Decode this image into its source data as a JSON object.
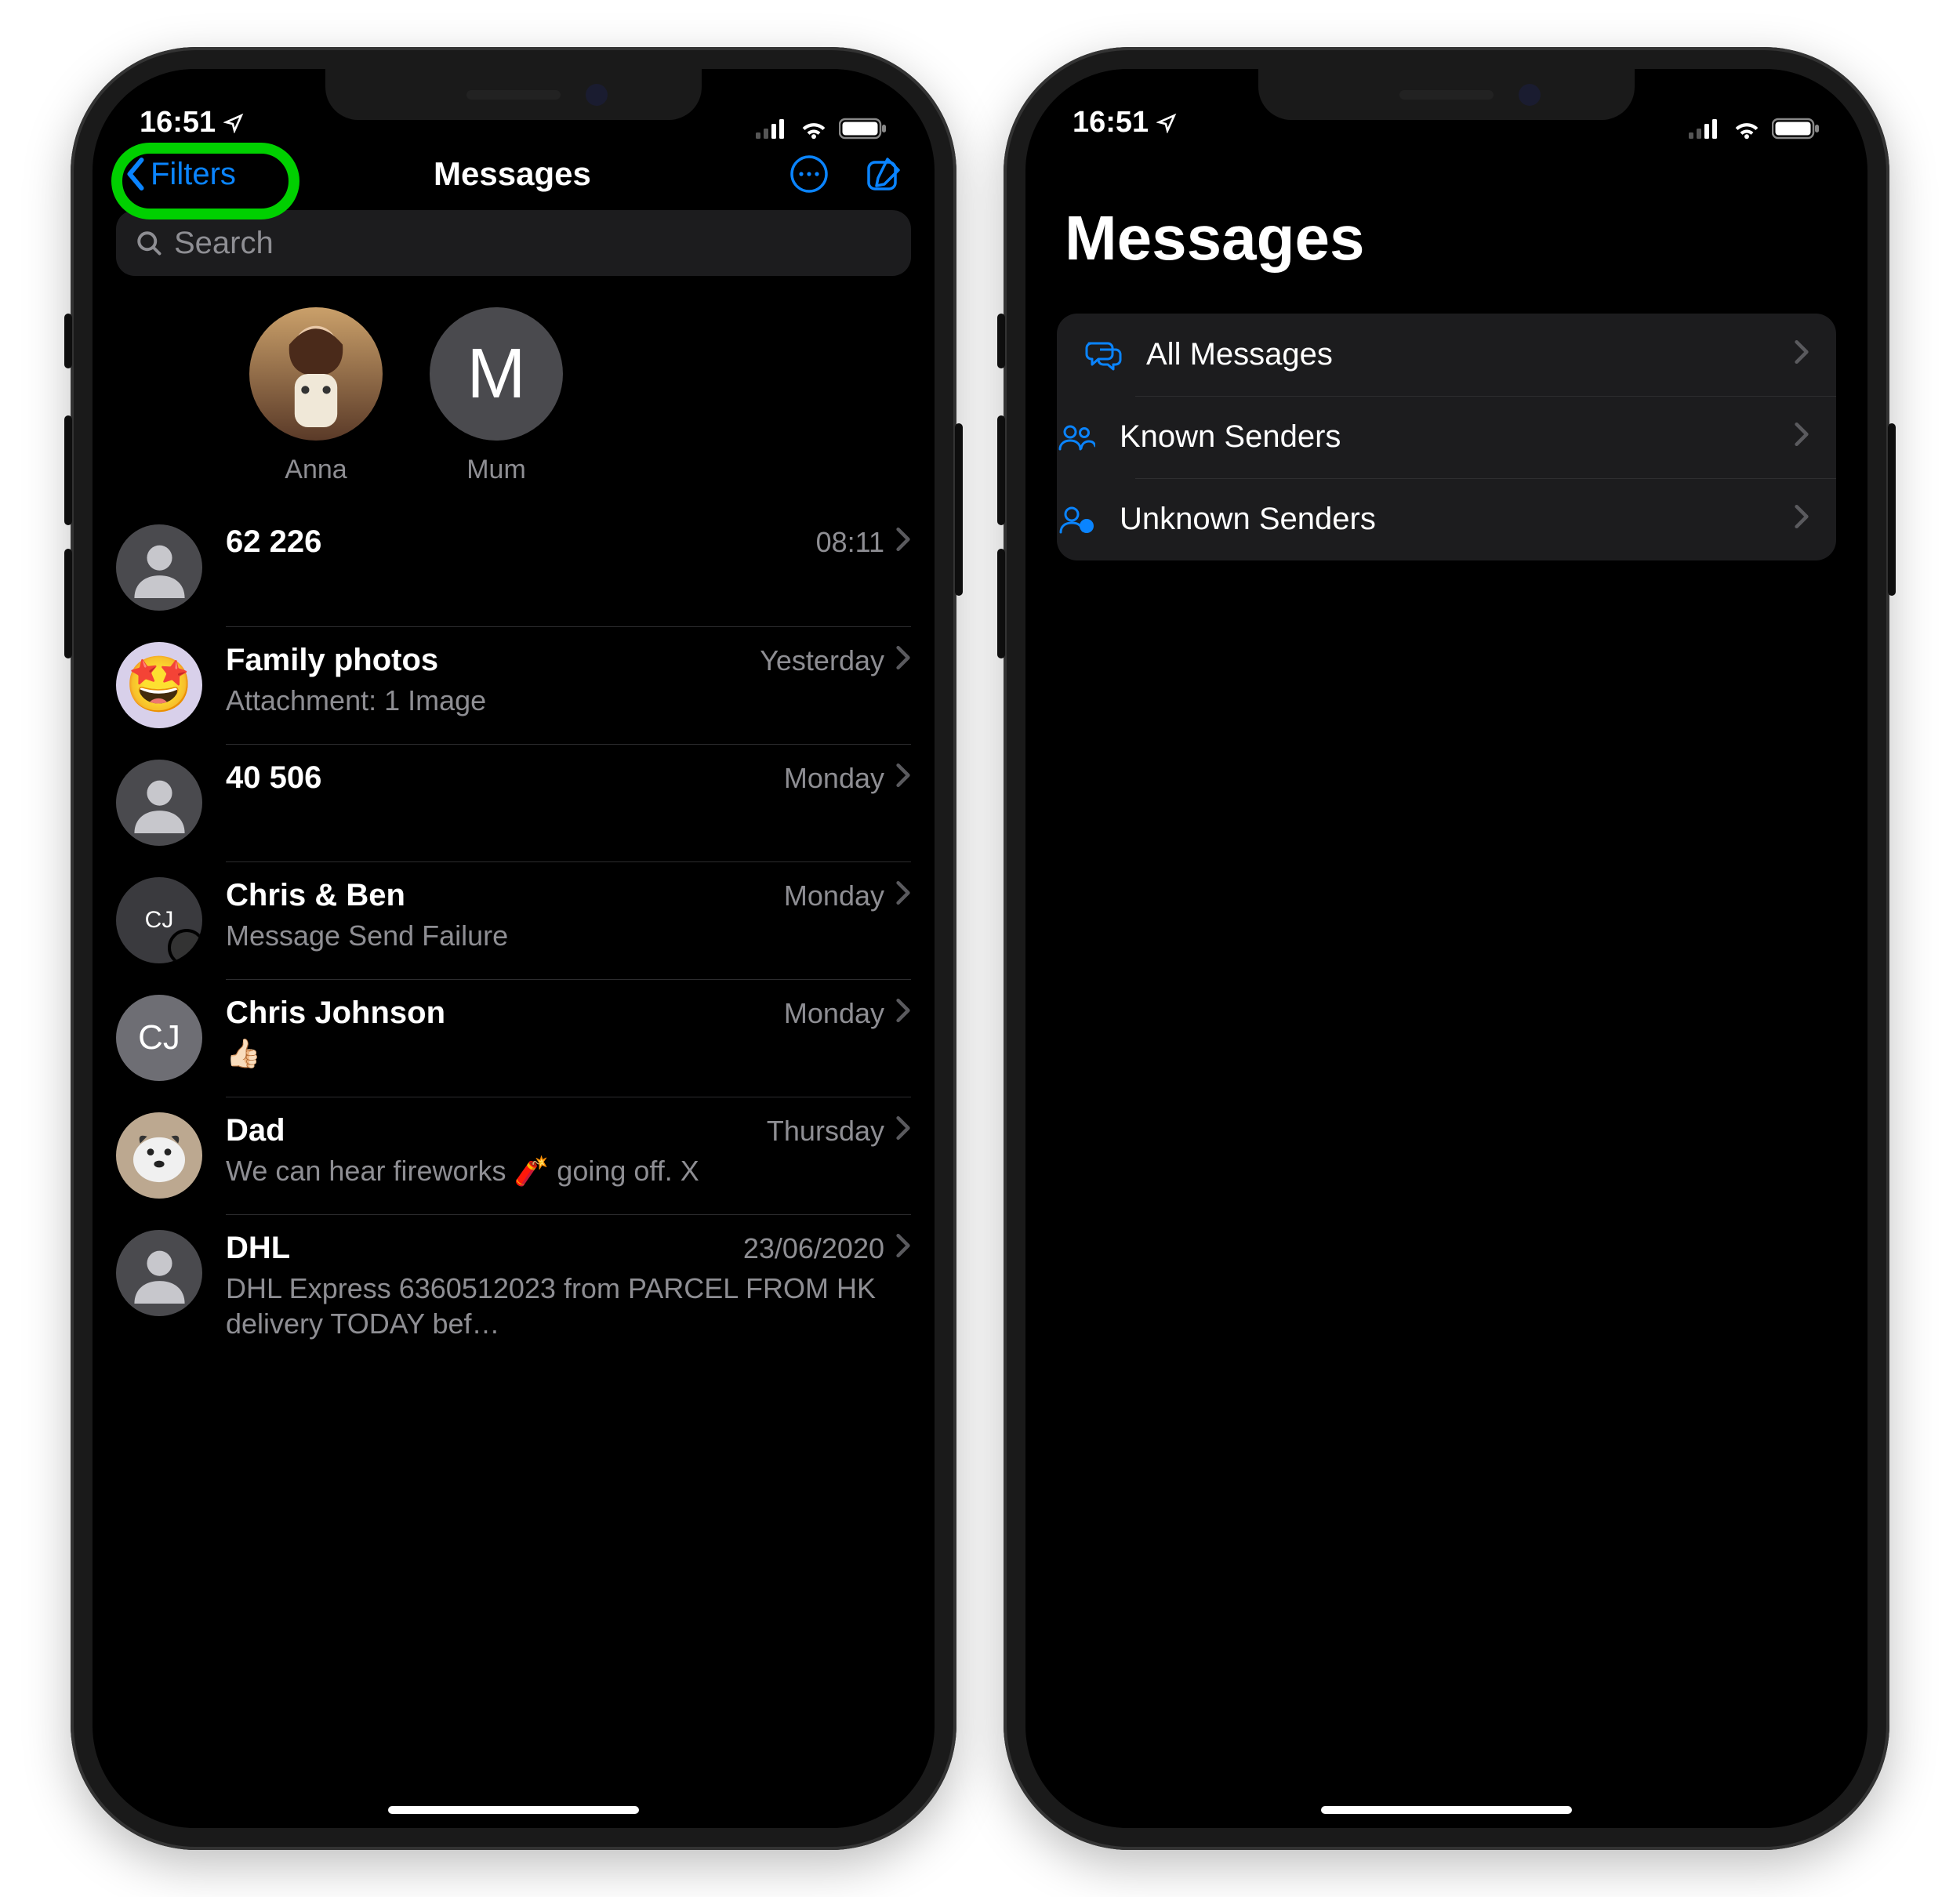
{
  "status": {
    "time": "16:51"
  },
  "left": {
    "nav": {
      "back_label": "Filters",
      "title": "Messages"
    },
    "search": {
      "placeholder": "Search"
    },
    "pinned": [
      {
        "name": "Anna",
        "initial": "",
        "type": "photo"
      },
      {
        "name": "Mum",
        "initial": "M",
        "type": "initial"
      }
    ],
    "conversations": [
      {
        "name": "62 226",
        "date": "08:11",
        "preview": "",
        "avatar": "person"
      },
      {
        "name": "Family photos",
        "date": "Yesterday",
        "preview": "Attachment: 1 Image",
        "avatar": "emoji",
        "emoji": "🤩"
      },
      {
        "name": "40 506",
        "date": "Monday",
        "preview": "",
        "avatar": "person"
      },
      {
        "name": "Chris & Ben",
        "date": "Monday",
        "preview": "Message Send Failure",
        "avatar": "initials-sm",
        "initials": "CJ"
      },
      {
        "name": "Chris Johnson",
        "date": "Monday",
        "preview": "👍🏻",
        "avatar": "initials",
        "initials": "CJ"
      },
      {
        "name": "Dad",
        "date": "Thursday",
        "preview": "We can hear fireworks 🧨 going off. X",
        "avatar": "dog"
      },
      {
        "name": "DHL",
        "date": "23/06/2020",
        "preview": "DHL Express 6360512023 from PARCEL FROM HK delivery TODAY bef…",
        "avatar": "person"
      }
    ]
  },
  "right": {
    "title": "Messages",
    "filters": [
      {
        "label": "All Messages",
        "icon": "bubbles"
      },
      {
        "label": "Known Senders",
        "icon": "people"
      },
      {
        "label": "Unknown Senders",
        "icon": "unknown"
      }
    ]
  }
}
